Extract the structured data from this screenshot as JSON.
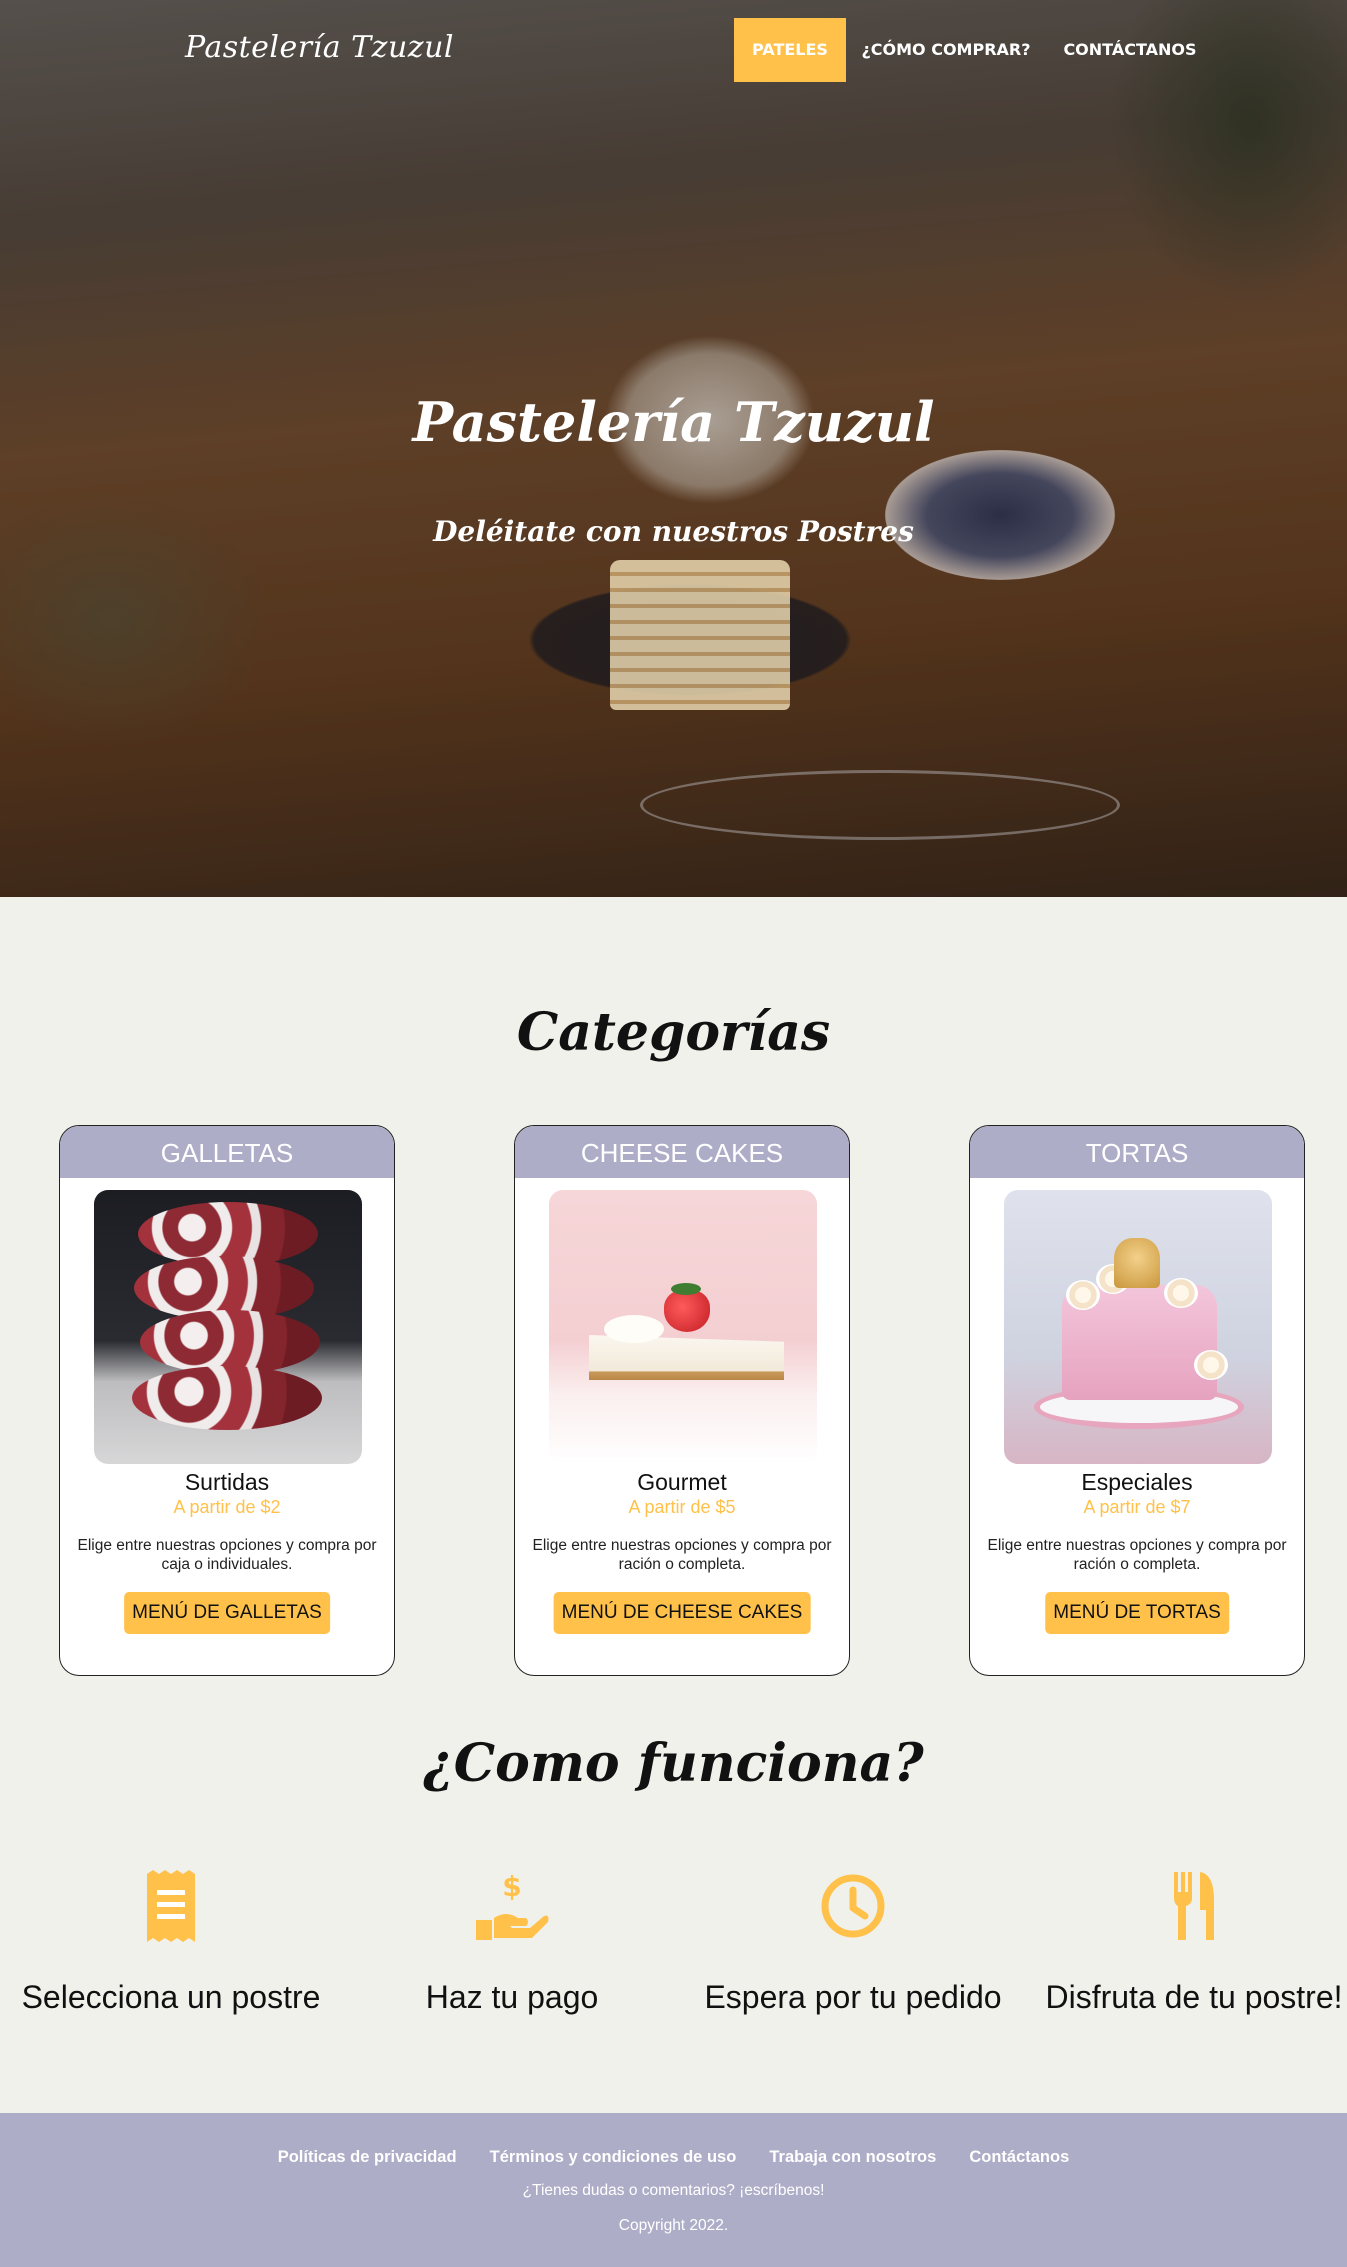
{
  "colors": {
    "accent": "#ffc14a",
    "card_header": "#aeadc8",
    "footer": "#aeadc8",
    "background": "#f1f1ec"
  },
  "nav": {
    "brand": "Pastelería Tzuzul",
    "items": [
      {
        "label": "PATELES",
        "active": true
      },
      {
        "label": "¿CÓMO COMPRAR?",
        "active": false
      },
      {
        "label": "CONTÁCTANOS",
        "active": false
      }
    ]
  },
  "hero": {
    "title": "Pastelería Tzuzul",
    "subtitle": "Deléitate con nuestros Postres"
  },
  "categories": {
    "title": "Categorías",
    "cards": [
      {
        "header": "GALLETAS",
        "name": "Surtidas",
        "price": "A partir de $2",
        "description": "Elige entre nuestras opciones y compra por caja o individuales.",
        "button": "MENÚ DE GALLETAS"
      },
      {
        "header": "CHEESE CAKES",
        "name": "Gourmet",
        "price": "A partir de $5",
        "description": "Elige entre nuestras opciones y compra por ración o completa.",
        "button": "MENÚ DE CHEESE CAKES"
      },
      {
        "header": "TORTAS",
        "name": "Especiales",
        "price": "A partir de $7",
        "description": "Elige entre nuestras opciones y compra por ración o completa.",
        "button": "MENÚ DE TORTAS"
      }
    ]
  },
  "how": {
    "title": "¿Como funciona?",
    "steps": [
      {
        "icon": "receipt-icon",
        "label": "Selecciona un postre"
      },
      {
        "icon": "hand-dollar-icon",
        "label": "Haz tu pago"
      },
      {
        "icon": "clock-icon",
        "label": "Espera por tu pedido"
      },
      {
        "icon": "utensils-icon",
        "label": "Disfruta de tu postre!"
      }
    ]
  },
  "footer": {
    "links": [
      "Políticas de privacidad",
      "Términos y condiciones de uso",
      "Trabaja con nosotros",
      "Contáctanos"
    ],
    "question": "¿Tienes dudas o comentarios? ¡escríbenos!",
    "copyright": "Copyright 2022."
  }
}
